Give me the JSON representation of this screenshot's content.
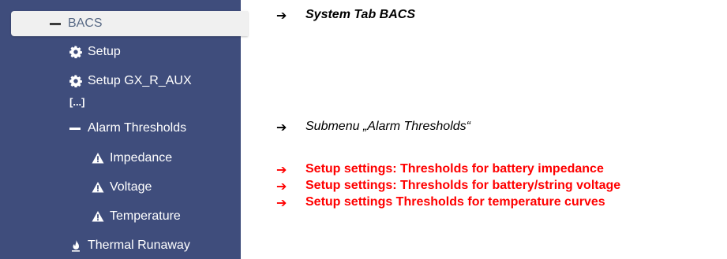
{
  "sidebar": {
    "items": [
      {
        "label": "BACS",
        "icon": "minus-icon"
      },
      {
        "label": "Setup",
        "icon": "gear-icon"
      },
      {
        "label": "Setup GX_R_AUX",
        "icon": "gear-icon"
      },
      {
        "label": "[...]"
      },
      {
        "label": "Alarm Thresholds",
        "icon": "minus-icon"
      },
      {
        "label": "Impedance",
        "icon": "warning-icon"
      },
      {
        "label": "Voltage",
        "icon": "warning-icon"
      },
      {
        "label": "Temperature",
        "icon": "warning-icon"
      },
      {
        "label": "Thermal Runaway",
        "icon": "flame-icon"
      }
    ],
    "bg_color": "#3f4d7c"
  },
  "annotations": [
    {
      "arrow": "➔",
      "text": "System Tab BACS",
      "color": "#000000",
      "style": "bold-italic"
    },
    {
      "arrow": "➔",
      "text": "Submenu „Alarm Thresholds“",
      "color": "#000000",
      "style": "italic"
    },
    {
      "arrow": "➔",
      "text": "Setup settings: Thresholds for battery impedance",
      "color": "#ff0000",
      "style": "bold"
    },
    {
      "arrow": "➔",
      "text": "Setup settings: Thresholds for battery/string voltage",
      "color": "#ff0000",
      "style": "bold"
    },
    {
      "arrow": "➔",
      "text": "Setup settings Thresholds for temperature curves",
      "color": "#ff0000",
      "style": "bold"
    }
  ]
}
